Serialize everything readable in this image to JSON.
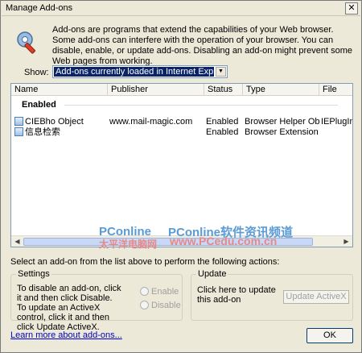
{
  "window": {
    "title": "Manage Add-ons",
    "close_label": "✕"
  },
  "intro": "Add-ons are programs that extend the capabilities of your Web browser. Some add-ons can interfere with the operation of your browser. You can disable, enable, or update add-ons. Disabling an add-on might prevent some Web pages from working.",
  "show": {
    "label": "Show:",
    "value": "Add-ons currently loaded in Internet Explorer"
  },
  "list": {
    "columns": [
      "Name",
      "Publisher",
      "Status",
      "Type",
      "File"
    ],
    "group": "Enabled",
    "rows": [
      {
        "name": "CIEBho Object",
        "publisher": "www.mail-magic.com",
        "status": "Enabled",
        "type": "Browser Helper Object",
        "file": "IEPlugIn.dl"
      },
      {
        "name": "信息检索",
        "publisher": "",
        "status": "Enabled",
        "type": "Browser Extension",
        "file": ""
      }
    ]
  },
  "watermark": {
    "brand": "PConline",
    "slogan": "PConline软件资讯频道",
    "cn": "太平洋电脑网",
    "url": "www.PCedu.com.cn"
  },
  "select_hint": "Select an add-on from the list above to perform the following actions:",
  "settings": {
    "legend": "Settings",
    "text": "To disable an add-on, click it and then click Disable. To update an ActiveX control, click it and then click Update ActiveX.",
    "enable": "Enable",
    "disable": "Disable"
  },
  "update": {
    "legend": "Update",
    "text": "Click here to update this add-on",
    "button": "Update ActiveX"
  },
  "footer": {
    "link": "Learn more about add-ons...",
    "ok": "OK"
  }
}
